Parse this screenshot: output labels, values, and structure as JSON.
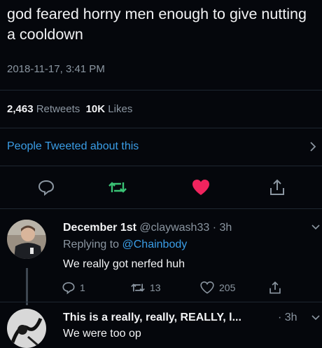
{
  "tweet": {
    "text": "god feared horny men enough to give nutting a cooldown",
    "timestamp": "2018-11-17, 3:41 PM",
    "retweets_count": "2,463",
    "retweets_label": "Retweets",
    "likes_count": "10K",
    "likes_label": "Likes",
    "people_tweeted": "People Tweeted about this"
  },
  "colors": {
    "background": "#05070c",
    "link": "#3a9de6",
    "like_active": "#f0245e",
    "secondary_text": "#8b96a1"
  },
  "reply1": {
    "name": "December 1st",
    "handle": "@claywash33",
    "sep": "·",
    "time": "3h",
    "replying_prefix": "Replying to",
    "replying_to": "@Chainbody",
    "text": "We really got nerfed huh",
    "reply_count": "1",
    "retweet_count": "13",
    "like_count": "205"
  },
  "reply2": {
    "name": "This is a really, really, REALLY, l...",
    "sep": "·",
    "time": "3h",
    "text": "We were too op"
  }
}
